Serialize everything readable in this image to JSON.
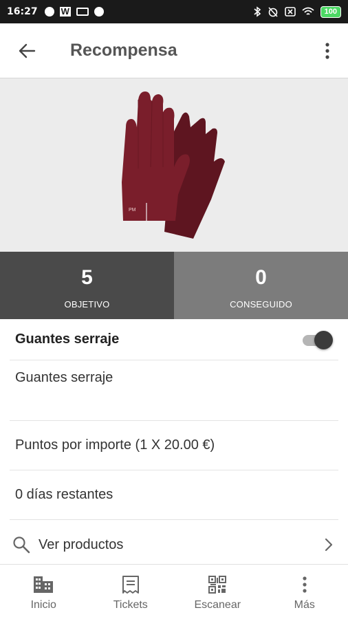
{
  "status_bar": {
    "time": "16:27",
    "battery": "100"
  },
  "app_bar": {
    "title": "Recompensa"
  },
  "stats": {
    "objective": {
      "value": "5",
      "label": "OBJETIVO"
    },
    "achieved": {
      "value": "0",
      "label": "CONSEGUIDO"
    }
  },
  "reward": {
    "name": "Guantes serraje",
    "active": true,
    "description": "Guantes serraje",
    "points_rule": "Puntos por importe (1 X 20.00 €)",
    "days_left": "0 días restantes",
    "view_products": "Ver productos"
  },
  "bottom_nav": [
    {
      "label": "Inicio",
      "icon": "building-icon"
    },
    {
      "label": "Tickets",
      "icon": "receipt-icon"
    },
    {
      "label": "Escanear",
      "icon": "qr-code-icon"
    },
    {
      "label": "Más",
      "icon": "more-vert-icon"
    }
  ],
  "colors": {
    "objective_bg": "#4a4a4a",
    "achieved_bg": "#7c7c7c",
    "glove": "#7a1e2b"
  }
}
